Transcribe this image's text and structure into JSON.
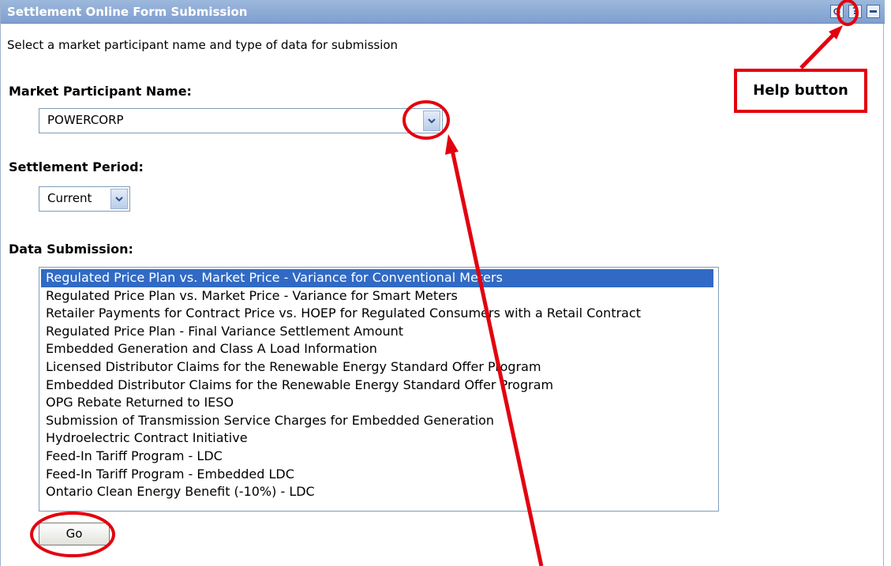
{
  "panel": {
    "title": "Settlement Online Form Submission",
    "intro": "Select a market participant name and type of data for submission"
  },
  "titlebar_buttons": {
    "refresh_icon": "refresh-icon",
    "help_icon": "help-icon",
    "minimize_icon": "minimize-icon"
  },
  "market_participant": {
    "label": "Market Participant Name:",
    "value": "POWERCORP"
  },
  "settlement_period": {
    "label": "Settlement Period:",
    "value": "Current"
  },
  "data_submission": {
    "label": "Data Submission:",
    "items": [
      "Regulated Price Plan vs. Market Price - Variance for Conventional Meters",
      "Regulated Price Plan vs. Market Price - Variance for Smart Meters",
      "Retailer Payments for Contract Price vs. HOEP for Regulated Consumers with a Retail Contract",
      "Regulated Price Plan - Final Variance Settlement Amount",
      "Embedded Generation and Class A Load Information",
      "Licensed Distributor Claims for the Renewable Energy Standard Offer Program",
      "Embedded Distributor Claims for the Renewable Energy Standard Offer Program",
      "OPG Rebate Returned to IESO",
      "Submission of Transmission Service Charges for Embedded Generation",
      "Hydroelectric Contract Initiative",
      "Feed-In Tariff Program - LDC",
      "Feed-In Tariff Program - Embedded LDC",
      "Ontario Clean Energy Benefit (-10%) - LDC"
    ],
    "selected_index": 0
  },
  "go_label": "Go",
  "annotation": {
    "callout_text": "Help button",
    "highlight_color": "#e3000f"
  },
  "colors": {
    "titlebar": "#8aa8d6",
    "selection": "#316ac5"
  }
}
